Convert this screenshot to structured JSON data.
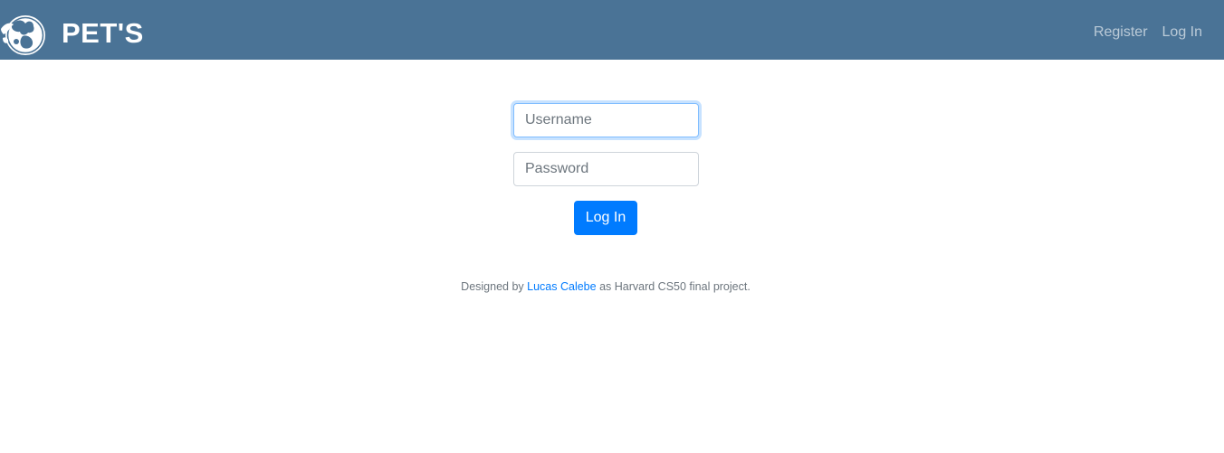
{
  "navbar": {
    "brand_name": "PET'S",
    "logo_icon": "pets-logo-icon",
    "links": [
      {
        "label": "Register"
      },
      {
        "label": "Log In"
      }
    ],
    "background_color": "#4a7396"
  },
  "login_form": {
    "username_placeholder": "Username",
    "password_placeholder": "Password",
    "submit_label": "Log In",
    "submit_color": "#007bff"
  },
  "footer": {
    "prefix": "Designed by ",
    "author_link": "Lucas Calebe",
    "suffix": " as Harvard CS50 final project."
  }
}
